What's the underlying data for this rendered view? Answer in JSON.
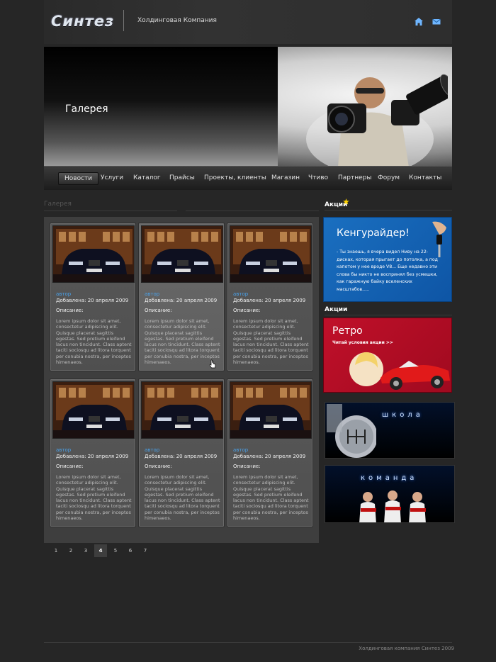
{
  "header": {
    "logo": "Синтез",
    "company": "Холдинговая Компания",
    "icons": [
      "home-icon",
      "mail-icon"
    ]
  },
  "banner": {
    "title": "Галерея"
  },
  "nav": {
    "items": [
      "Новости",
      "Услуги",
      "Каталог",
      "Прайсы",
      "Проекты, клиенты",
      "Магазин",
      "Чтиво",
      "Партнеры",
      "Форум",
      "Контакты"
    ],
    "active": "Новости"
  },
  "gallery": {
    "title": "Галерея",
    "cards": [
      {
        "author": "автор",
        "date": "Добавлена: 20 апреля 2009",
        "desc_label": "Описание:",
        "text": "Lorem ipsum dolor sit amet, consectetur adipiscing elit. Quisque placerat sagittis egestas. Sed pretium eleifend lacus non tincidunt. Class aptent taciti sociosqu ad litora torquent per conubia nostra, per inceptos himenaeos."
      },
      {
        "author": "автор",
        "date": "Добавлена: 20 апреля 2009",
        "desc_label": "Описание:",
        "text": "Lorem ipsum dolor sit amet, consectetur adipiscing elit. Quisque placerat sagittis egestas. Sed pretium eleifend lacus non tincidunt. Class aptent taciti sociosqu ad litora torquent per conubia nostra, per inceptos himenaeos."
      },
      {
        "author": "автор",
        "date": "Добавлена: 20 апреля 2009",
        "desc_label": "Описание:",
        "text": "Lorem ipsum dolor sit amet, consectetur adipiscing elit. Quisque placerat sagittis egestas. Sed pretium eleifend lacus non tincidunt. Class aptent taciti sociosqu ad litora torquent per conubia nostra, per inceptos himenaeos."
      },
      {
        "author": "автор",
        "date": "Добавлена: 20 апреля 2009",
        "desc_label": "Описание:",
        "text": "Lorem ipsum dolor sit amet, consectetur adipiscing elit. Quisque placerat sagittis egestas. Sed pretium eleifend lacus non tincidunt. Class aptent taciti sociosqu ad litora torquent per conubia nostra, per inceptos himenaeos."
      },
      {
        "author": "автор",
        "date": "Добавлена: 20 апреля 2009",
        "desc_label": "Описание:",
        "text": "Lorem ipsum dolor sit amet, consectetur adipiscing elit. Quisque placerat sagittis egestas. Sed pretium eleifend lacus non tincidunt. Class aptent taciti sociosqu ad litora torquent per conubia nostra, per inceptos himenaeos."
      },
      {
        "author": "автор",
        "date": "Добавлена: 20 апреля 2009",
        "desc_label": "Описание:",
        "text": "Lorem ipsum dolor sit amet, consectetur adipiscing elit. Quisque placerat sagittis egestas. Sed pretium eleifend lacus non tincidunt. Class aptent taciti sociosqu ad litora torquent per conubia nostra, per inceptos himenaeos."
      }
    ]
  },
  "pagination": {
    "pages": [
      "1",
      "2",
      "3",
      "4",
      "5",
      "6",
      "7"
    ],
    "current": "4"
  },
  "sidebar": {
    "section1": "Акции",
    "section2": "Акции",
    "kanga": {
      "title": "Кенгурайдер!",
      "text": "- Ты знаешь, я вчера видел Ниву на 22-дисках, которая прыгает до потолка, а под капотом у нее вроде V8... Еще недавно эти слова бы никто не воспринял без усмешки, как гаражную байку вселенских масштабов....."
    },
    "retro": {
      "title": "Ретро",
      "sub": "Читай условия акции >>"
    },
    "school": {
      "word": "школа"
    },
    "team": {
      "word": "команда"
    }
  },
  "footer": {
    "text": "Холдинговая компания Синтез 2009"
  },
  "colors": {
    "background": "#262626",
    "panel": "#3e3e3e",
    "link": "#4aa0e8",
    "promo_blue": "#1a6fc0",
    "promo_red": "#c0102a"
  }
}
